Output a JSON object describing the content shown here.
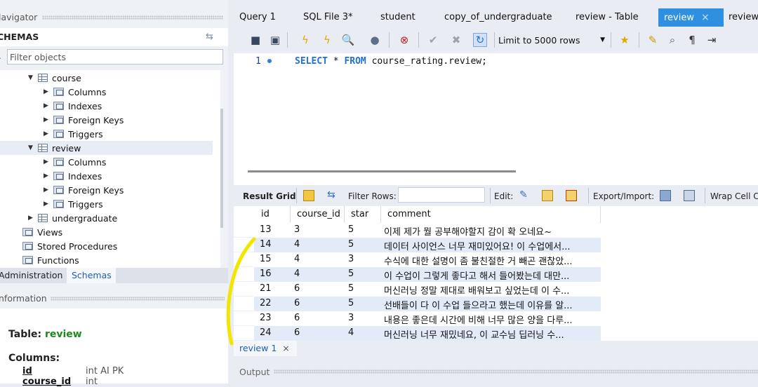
{
  "left_panel": {
    "navigator_label": "lavigator",
    "schemas_title": "CHEMAS",
    "filter_placeholder": "Filter objects",
    "tree": [
      {
        "label": "course",
        "kind": "table",
        "expanded": true
      },
      {
        "label": "Columns",
        "kind": "folder"
      },
      {
        "label": "Indexes",
        "kind": "folder"
      },
      {
        "label": "Foreign Keys",
        "kind": "folder"
      },
      {
        "label": "Triggers",
        "kind": "folder"
      },
      {
        "label": "review",
        "kind": "table",
        "expanded": true,
        "selected": true
      },
      {
        "label": "Columns",
        "kind": "folder"
      },
      {
        "label": "Indexes",
        "kind": "folder"
      },
      {
        "label": "Foreign Keys",
        "kind": "folder"
      },
      {
        "label": "Triggers",
        "kind": "folder"
      },
      {
        "label": "undergraduate",
        "kind": "table",
        "expanded": false
      },
      {
        "label": "Views",
        "kind": "folder"
      },
      {
        "label": "Stored Procedures",
        "kind": "folder"
      },
      {
        "label": "Functions",
        "kind": "folder"
      }
    ],
    "tab_administration": "Administration",
    "tab_schemas": "Schemas",
    "information_label": "nformation",
    "info": {
      "table_prefix": "Table:",
      "table_name": "review",
      "columns_label": "Columns:",
      "columns": [
        {
          "name": "id",
          "type": "int AI PK"
        },
        {
          "name": "course_id",
          "type": "int"
        }
      ]
    }
  },
  "query_tabs": [
    {
      "label": "Query 1"
    },
    {
      "label": "SQL File 3*"
    },
    {
      "label": "student"
    },
    {
      "label": "copy_of_undergraduate"
    },
    {
      "label": "review - Table"
    },
    {
      "label": "review",
      "active": true
    },
    {
      "label": "review"
    }
  ],
  "toolbar": {
    "limit_label": "Limit to 5000 rows"
  },
  "editor": {
    "line_number": "1",
    "sql_keyword_select": "SELECT",
    "sql_star": " * ",
    "sql_keyword_from": "FROM",
    "sql_rest": " course_rating.review;"
  },
  "result_bar": {
    "result_grid_label": "Result Grid",
    "filter_rows_label": "Filter Rows:",
    "edit_label": "Edit:",
    "export_label": "Export/Import:",
    "wrap_label": "Wrap Cell C"
  },
  "grid": {
    "headers": [
      "id",
      "course_id",
      "star",
      "comment"
    ],
    "rows": [
      [
        "13",
        "3",
        "5",
        "이제 제가 뭘 공부해야할지 감이 확 오네요~"
      ],
      [
        "14",
        "4",
        "5",
        "데이터 사이언스 너무 재미있어요! 이 수업에서..."
      ],
      [
        "15",
        "4",
        "3",
        "수식에 대한 설명이 좀 불친절한 거 빼곤 괜찮았..."
      ],
      [
        "16",
        "4",
        "5",
        "이 수업이 그렇게 좋다고 해서 들어봤는데 대만..."
      ],
      [
        "21",
        "6",
        "5",
        "머신러닝 정말 제대로 배워보고 싶었는데 이 수..."
      ],
      [
        "22",
        "6",
        "5",
        "선배들이 다 이 수업 들으라고 했는데 이유를 알..."
      ],
      [
        "23",
        "6",
        "3",
        "내용은 좋은데 시간에 비해 너무 많은 양을 다루..."
      ],
      [
        "24",
        "6",
        "4",
        "머신러닝 너무 재밌네요, 이 교수님 딥러닝 수..."
      ]
    ]
  },
  "bottom": {
    "result_tab": "review 1",
    "result_tab_close": "×",
    "output_label": "Output"
  },
  "colors": {
    "active_tab": "#2f8fe0",
    "keyword": "#1f6fd8",
    "table_name": "#1c8a1c",
    "highlighter": "#f2e600"
  }
}
